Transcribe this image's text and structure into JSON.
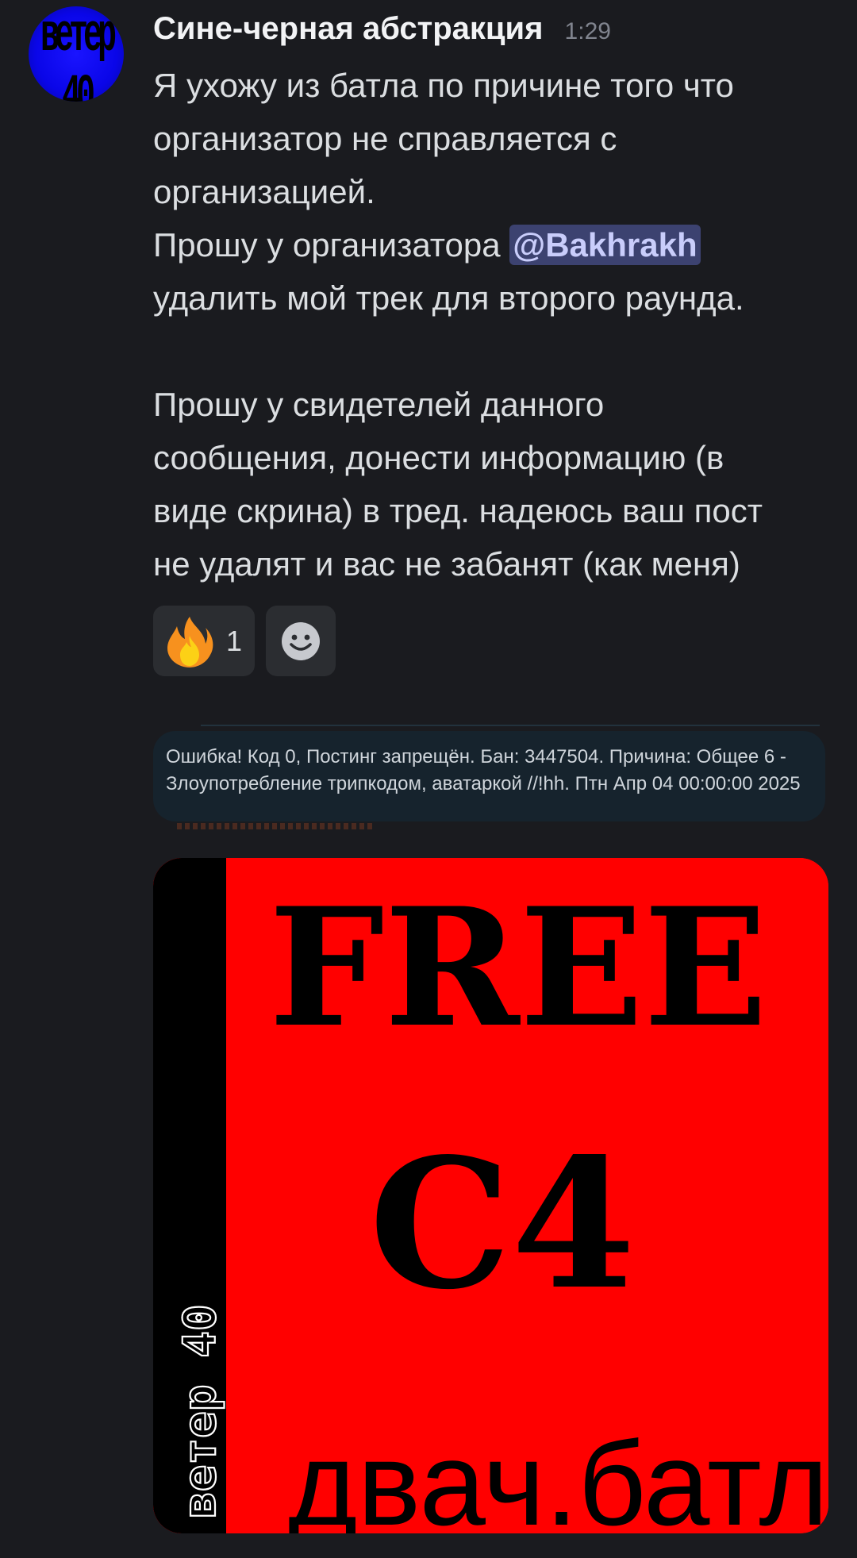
{
  "message": {
    "author": "Сине-черная абстракция",
    "timestamp": "1:29",
    "avatar_text": "ветер 40",
    "paragraphs": [
      {
        "lines": [
          "Я ухожу из батла по причине того что",
          "организатор не справляется с",
          "организацией."
        ]
      },
      {
        "prefix": "Прошу у организатора ",
        "mention": "@Bakhrakh",
        "suffix": "удалить мой трек для второго раунда."
      },
      {
        "lines": [
          "Прошу у свидетелей данного",
          "сообщения, донести информацию (в",
          "виде скрина) в тред. надеюсь ваш пост",
          "не удалят и вас не забанят (как меня)"
        ]
      }
    ],
    "reactions": [
      {
        "emoji": "fire-icon",
        "count": "1"
      },
      {
        "emoji": "add-reaction-icon"
      }
    ],
    "embedded_screenshot": {
      "error_text": "Ошибка! Код 0, Постинг запрещён. Бан: 3447504. Причина: Общее 6 - Злоупотребление трипкодом, аватаркой //!hh. Птн Апр 04 00:00:00 2025"
    },
    "image": {
      "line1": "FREE",
      "line2": "C4",
      "bottom_text": "двач.батл",
      "side_text": "ветер 40",
      "background": "#ff0000",
      "stripe_color": "#000000"
    }
  },
  "colors": {
    "background": "#1a1b1f",
    "mention_bg": "#3c4270",
    "mention_fg": "#c9cdfb",
    "reaction_bg": "#2b2d31",
    "error_box_bg": "#16232d"
  }
}
